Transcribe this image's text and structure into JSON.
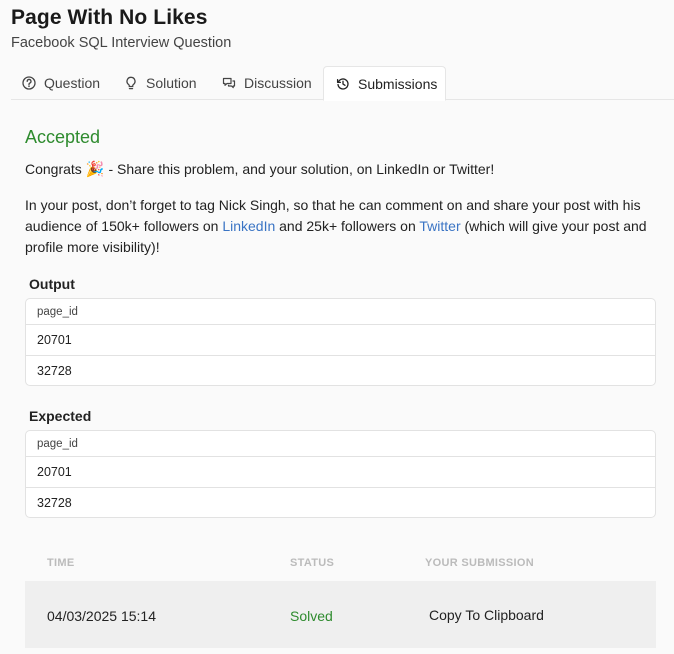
{
  "header": {
    "title": "Page With No Likes",
    "subtitle": "Facebook SQL Interview Question"
  },
  "tabs": [
    {
      "label": "Question",
      "icon": "question-circle-icon"
    },
    {
      "label": "Solution",
      "icon": "lightbulb-icon"
    },
    {
      "label": "Discussion",
      "icon": "chat-bubbles-icon"
    },
    {
      "label": "Submissions",
      "icon": "history-icon",
      "active": true
    }
  ],
  "result": {
    "status": "Accepted",
    "congrats_before": "Congrats",
    "congrats_emoji": "🎉",
    "congrats_after": "- Share this problem, and your solution, on LinkedIn or Twitter!",
    "para_1": "In your post, don’t forget to tag Nick Singh, so that he can comment on and share your post with his audience of 150k+ followers on ",
    "linkedin_label": "LinkedIn",
    "para_2": " and 25k+ followers on ",
    "twitter_label": "Twitter",
    "para_3": " (which will give your post and profile more visibility)!"
  },
  "output": {
    "label": "Output",
    "column": "page_id",
    "rows": [
      "20701",
      "32728"
    ]
  },
  "expected": {
    "label": "Expected",
    "column": "page_id",
    "rows": [
      "20701",
      "32728"
    ]
  },
  "submissions": {
    "headers": {
      "time": "TIME",
      "status": "STATUS",
      "submission": "YOUR SUBMISSION"
    },
    "rows": [
      {
        "time": "04/03/2025 15:14",
        "status": "Solved",
        "action": "Copy To Clipboard"
      }
    ]
  },
  "colors": {
    "accent_green": "#2e8b2e",
    "link_blue": "#3a74c4"
  }
}
